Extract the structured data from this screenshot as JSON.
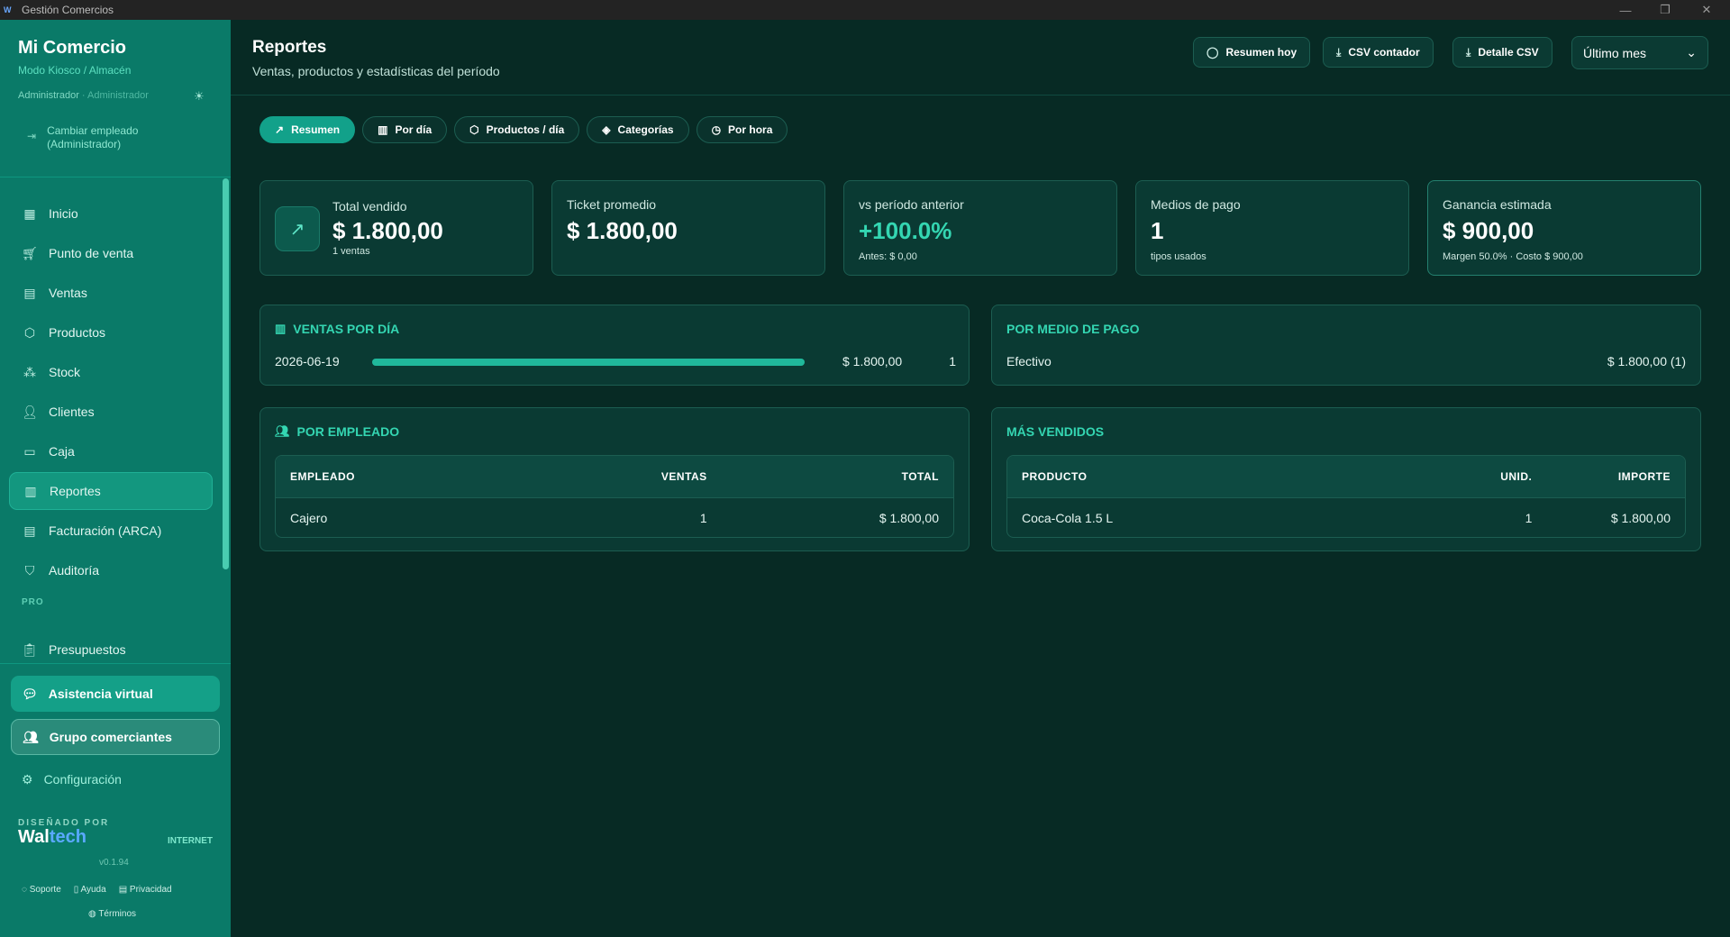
{
  "window": {
    "title": "Gestión Comercios",
    "minimize": "—",
    "restore": "❐",
    "close": "✕"
  },
  "sidebar": {
    "brand_name": "Mi Comercio",
    "brand_mode": "Modo Kiosco / Almacén",
    "role_primary": "Administrador",
    "role_secondary": " · Administrador",
    "switch_label_1": "Cambiar empleado",
    "switch_label_2": "(Administrador)",
    "items": [
      {
        "label": "Inicio",
        "icon": "grid-icon"
      },
      {
        "label": "Punto de venta",
        "icon": "cart-icon"
      },
      {
        "label": "Ventas",
        "icon": "receipt-icon"
      },
      {
        "label": "Productos",
        "icon": "box-icon"
      },
      {
        "label": "Stock",
        "icon": "cubes-icon"
      },
      {
        "label": "Clientes",
        "icon": "users-icon"
      },
      {
        "label": "Caja",
        "icon": "cashbox-icon"
      },
      {
        "label": "Reportes",
        "icon": "bar-chart-icon",
        "active": true
      },
      {
        "label": "Facturación (ARCA)",
        "icon": "invoice-icon"
      },
      {
        "label": "Auditoría",
        "icon": "shield-icon"
      }
    ],
    "pro_label": "PRO",
    "pro_items": [
      {
        "label": "Presupuestos",
        "icon": "clipboard-icon"
      }
    ],
    "asistencia": "Asistencia virtual",
    "grupo": "Grupo comerciantes",
    "config": "Configuración",
    "designed_by": "DISEÑADO POR",
    "logo_wal": "Wal",
    "logo_tech": "tech",
    "connection": "INTERNET",
    "version": "v0.1.94",
    "links": [
      "Soporte",
      "Ayuda",
      "Privacidad"
    ],
    "link_terminos": "Términos",
    "accent": "#0a7a68"
  },
  "header": {
    "title": "Reportes",
    "subtitle": "Ventas, productos y estadísticas del período",
    "btn_resumen": "Resumen hoy",
    "btn_csv_contador": "CSV contador",
    "btn_detalle_csv": "Detalle CSV",
    "period": "Último mes"
  },
  "tabs": [
    "Resumen",
    "Por día",
    "Productos / día",
    "Categorías",
    "Por hora"
  ],
  "cards": {
    "total": {
      "label": "Total vendido",
      "value": "$ 1.800,00",
      "sub": "1 ventas"
    },
    "ticket": {
      "label": "Ticket promedio",
      "value": "$ 1.800,00"
    },
    "vs": {
      "label": "vs período anterior",
      "value": "+100.0%",
      "sub": "Antes: $ 0,00"
    },
    "medios": {
      "label": "Medios de pago",
      "value": "1",
      "sub": "tipos usados"
    },
    "ganancia": {
      "label": "Ganancia estimada",
      "value": "$ 900,00",
      "sub": "Margen 50.0% · Costo $ 900,00"
    }
  },
  "ventas_dia": {
    "title": "VENTAS POR DÍA",
    "rows": [
      {
        "date": "2026-06-19",
        "amount": "$ 1.800,00",
        "count": "1",
        "fraction": 1.0
      }
    ]
  },
  "medio_pago": {
    "title": "POR MEDIO DE PAGO",
    "rows": [
      {
        "name": "Efectivo",
        "value": "$ 1.800,00 (1)"
      }
    ]
  },
  "empleado": {
    "title": "POR EMPLEADO",
    "headers": [
      "EMPLEADO",
      "VENTAS",
      "TOTAL"
    ],
    "rows": [
      {
        "name": "Cajero",
        "ventas": "1",
        "total": "$ 1.800,00"
      }
    ]
  },
  "mas_vendidos": {
    "title": "MÁS VENDIDOS",
    "headers": [
      "PRODUCTO",
      "UNID.",
      "IMPORTE"
    ],
    "rows": [
      {
        "name": "Coca-Cola 1.5 L",
        "unid": "1",
        "importe": "$ 1.800,00"
      }
    ]
  }
}
